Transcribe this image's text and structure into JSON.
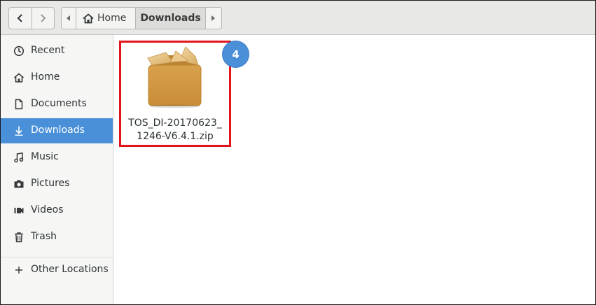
{
  "window": {
    "nav": {
      "back": "back",
      "forward": "forward"
    },
    "pathbar": {
      "crumbs": [
        {
          "label": "Home",
          "icon": "home-icon"
        },
        {
          "label": "Downloads"
        }
      ]
    }
  },
  "sidebar": {
    "items": [
      {
        "label": "Recent",
        "icon": "clock-icon",
        "active": false
      },
      {
        "label": "Home",
        "icon": "home-icon",
        "active": false
      },
      {
        "label": "Documents",
        "icon": "document-icon",
        "active": false
      },
      {
        "label": "Downloads",
        "icon": "download-icon",
        "active": true
      },
      {
        "label": "Music",
        "icon": "music-note-icon",
        "active": false
      },
      {
        "label": "Pictures",
        "icon": "camera-icon",
        "active": false
      },
      {
        "label": "Videos",
        "icon": "film-icon",
        "active": false
      },
      {
        "label": "Trash",
        "icon": "trash-icon",
        "active": false
      },
      {
        "label": "Other Locations",
        "icon": "plus-icon",
        "active": false
      }
    ]
  },
  "content": {
    "files": [
      {
        "name_line1": "TOS_DI-20170623_",
        "name_line2": "1246-V6.4.1.zip",
        "icon": "package-icon"
      }
    ],
    "callout_badge": "4"
  },
  "colors": {
    "accent": "#4a90d9",
    "highlight_border": "#e0141a",
    "badge": "#4c8fd9"
  }
}
